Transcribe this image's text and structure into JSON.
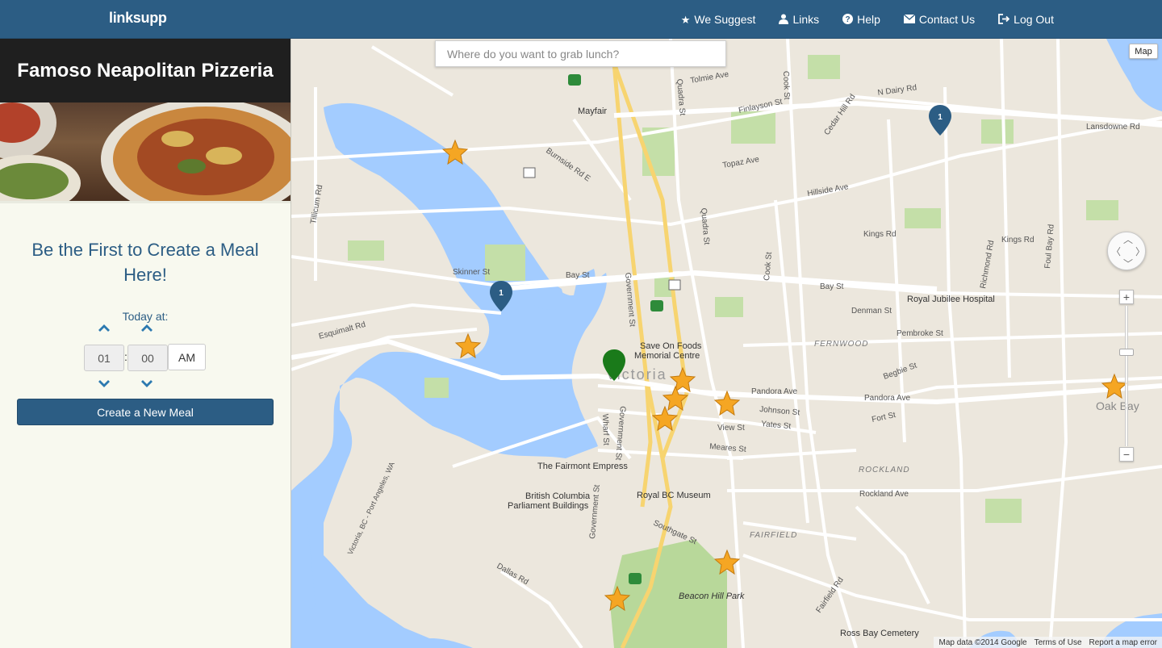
{
  "app": {
    "brand": "linksupp"
  },
  "nav": {
    "items": [
      {
        "label": "We Suggest",
        "icon": "star-icon"
      },
      {
        "label": "Links",
        "icon": "user-icon"
      },
      {
        "label": "Help",
        "icon": "question-icon"
      },
      {
        "label": "Contact Us",
        "icon": "envelope-icon"
      },
      {
        "label": "Log Out",
        "icon": "logout-icon"
      }
    ]
  },
  "sidebar": {
    "restaurant_name": "Famoso Neapolitan Pizzeria",
    "headline": "Be the First to Create a Meal Here!",
    "today_label": "Today at:",
    "time": {
      "hour": "01",
      "minute": "00",
      "separator": ":",
      "ampm": "AM"
    },
    "create_button": "Create a New Meal"
  },
  "map": {
    "search_placeholder": "Where do you want to grab lunch?",
    "map_type": "Map",
    "zoom_in": "+",
    "zoom_out": "−",
    "footer": {
      "data": "Map data ©2014 Google",
      "terms": "Terms of Use",
      "report": "Report a map error"
    },
    "places": {
      "city": "Victoria",
      "mayfair": "Mayfair",
      "save_on_foods": "Save On Foods",
      "memorial_centre": "Memorial Centre",
      "royal_jubilee": "Royal Jubilee Hospital",
      "fairmont": "The Fairmont Empress",
      "royal_bc": "Royal BC Museum",
      "bc_parliament_1": "British Columbia",
      "bc_parliament_2": "Parliament Buildings",
      "beacon_hill": "Beacon Hill Park",
      "ross_bay": "Ross Bay Cemetery",
      "fernwood": "FERNWOOD",
      "rockland": "ROCKLAND",
      "fairfield": "FAIRFIELD",
      "oak_bay": "Oak Bay",
      "ferry_route": "Victoria, BC - Port Angeles, WA"
    },
    "streets": {
      "finlayson": "Finlayson St",
      "hillside": "Hillside Ave",
      "bay": "Bay St",
      "pandora": "Pandora Ave",
      "johnson": "Johnson St",
      "yates": "Yates St",
      "fort": "Fort St",
      "view": "View St",
      "meares": "Meares St",
      "quadra": "Quadra St",
      "government": "Government St",
      "cook": "Cook St",
      "richmond": "Richmond Rd",
      "foul_bay": "Foul Bay Rd",
      "dallas": "Dallas Rd",
      "fairfield_rd": "Fairfield Rd",
      "southgate": "Southgate St",
      "skinner": "Skinner St",
      "esquimalt": "Esquimalt Rd",
      "tillicum": "Tillicum Rd",
      "burnside": "Burnside Rd E",
      "n_dairy": "N Dairy Rd",
      "lansdowne": "Lansdowne Rd",
      "kings": "Kings Rd",
      "denman": "Denman St",
      "pembroke": "Pembroke St",
      "begbie": "Begbie St",
      "rockland_ave": "Rockland Ave",
      "topaz": "Topaz Ave",
      "cedar_hill": "Cedar Hill Rd",
      "wharf": "Wharf St",
      "tolmie": "Tolmie Ave"
    },
    "cluster_markers": [
      {
        "count": "1"
      },
      {
        "count": "1"
      }
    ]
  }
}
